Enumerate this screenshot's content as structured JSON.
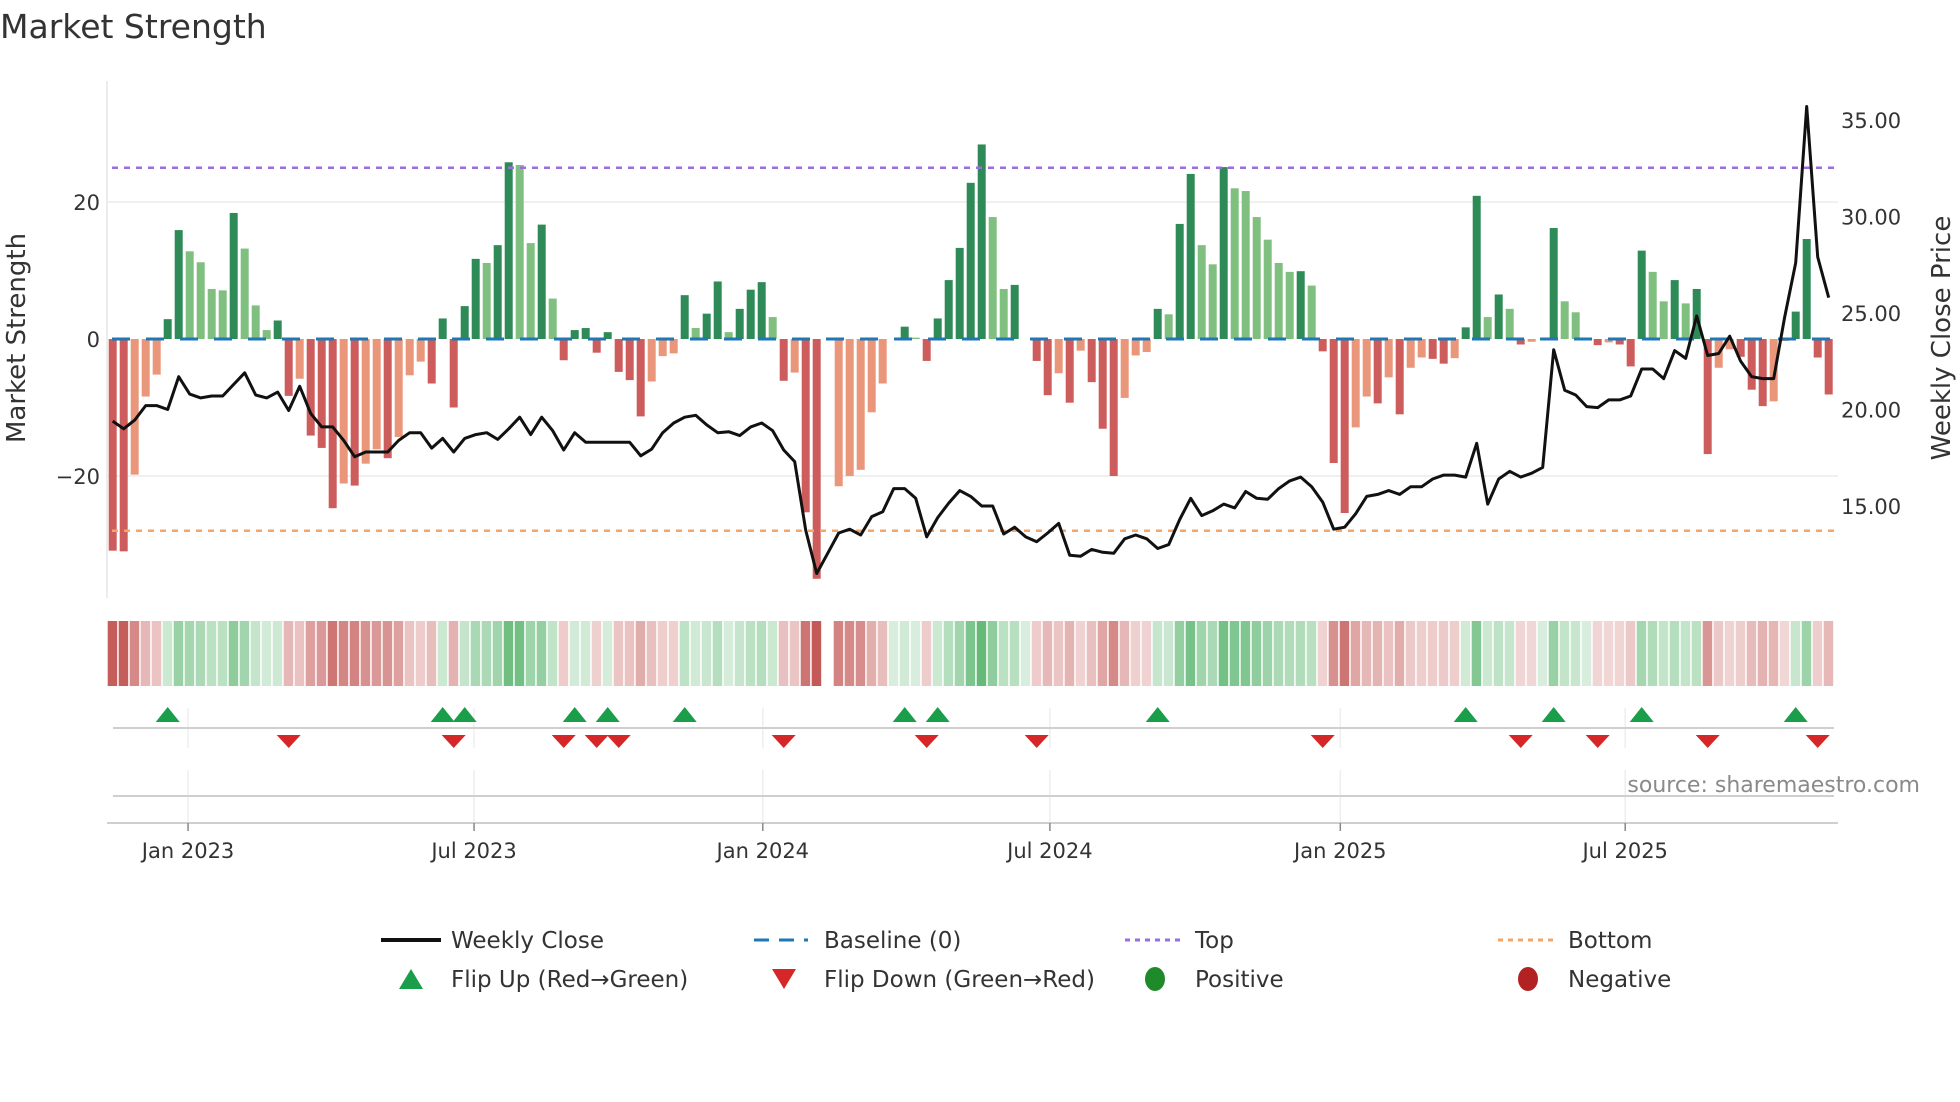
{
  "title": "Market Strength",
  "source": "source: sharemaestro.com",
  "chart_data": {
    "type": "bar",
    "title": "Market Strength",
    "ylabel": "Market Strength",
    "y2label": "Weekly Close Price",
    "ylim": [
      -38,
      35
    ],
    "y2lim": [
      10.5,
      36.5
    ],
    "yticks": [
      {
        "v": 20,
        "label": "20"
      },
      {
        "v": 0,
        "label": "0"
      },
      {
        "v": -20,
        "label": "−20"
      }
    ],
    "y2ticks": [
      {
        "v": 35,
        "label": "35.00"
      },
      {
        "v": 30,
        "label": "30.00"
      },
      {
        "v": 25,
        "label": "25.00"
      },
      {
        "v": 20,
        "label": "20.00"
      },
      {
        "v": 15,
        "label": "15.00"
      }
    ],
    "xticks": [
      {
        "week": 6.85,
        "label": "Jan 2023"
      },
      {
        "week": 32.85,
        "label": "Jul 2023"
      },
      {
        "week": 59.1,
        "label": "Jan 2024"
      },
      {
        "week": 85.2,
        "label": "Jul 2024"
      },
      {
        "week": 111.6,
        "label": "Jan 2025"
      },
      {
        "week": 137.5,
        "label": "Jul 2025"
      }
    ],
    "top_level": 25,
    "bottom_level": -28,
    "baseline": 0,
    "grid": true,
    "strength": [
      -30.9,
      -31,
      -19.8,
      -8.4,
      -5.2,
      2.9,
      15.9,
      12.8,
      11.2,
      7.3,
      7.1,
      18.4,
      13.2,
      4.9,
      1.3,
      2.7,
      -8.3,
      -5.8,
      -14.1,
      -15.9,
      -24.7,
      -21.1,
      -21.4,
      -18.2,
      -16.1,
      -17.4,
      -14.3,
      -5.3,
      -3.3,
      -6.5,
      3.0,
      -10.0,
      4.8,
      11.7,
      11.1,
      13.7,
      25.8,
      25.4,
      14.0,
      16.7,
      5.9,
      -3.1,
      1.3,
      1.6,
      -2.0,
      1.0,
      -4.8,
      -6.0,
      -11.3,
      -6.2,
      -2.5,
      -2.1,
      6.4,
      1.6,
      3.7,
      8.4,
      1.0,
      4.4,
      7.2,
      8.3,
      3.2,
      -6.1,
      -4.9,
      -25.3,
      -35.0,
      null,
      -21.5,
      -20.0,
      -19.1,
      -10.7,
      -6.5,
      0,
      1.8,
      0.2,
      -3.2,
      3.0,
      8.6,
      13.3,
      22.8,
      28.4,
      17.8,
      7.3,
      7.9,
      0,
      -3.2,
      -8.2,
      -5.0,
      -9.3,
      -1.7,
      -6.3,
      -13.1,
      -20.0,
      -8.6,
      -2.4,
      -1.9,
      4.4,
      3.6,
      16.8,
      24.1,
      13.7,
      10.9,
      25.1,
      22.0,
      21.6,
      17.8,
      14.5,
      11.1,
      9.8,
      9.9,
      7.8,
      -1.8,
      -18.1,
      -25.4,
      -12.9,
      -8.4,
      -9.4,
      -5.6,
      -11.0,
      -4.2,
      -2.7,
      -2.9,
      -3.6,
      -2.8,
      1.7,
      20.9,
      3.2,
      6.5,
      4.4,
      -0.8,
      -0.4,
      0,
      16.2,
      5.5,
      3.9,
      0,
      -0.9,
      -0.5,
      -0.8,
      -4.0,
      12.9,
      9.8,
      5.5,
      8.6,
      5.2,
      7.3,
      -16.8,
      -4.2,
      -1.5,
      -2.6,
      -7.4,
      -9.8,
      -9.1,
      -0.3,
      4.0,
      14.6,
      -2.7,
      -8.1
    ],
    "weekly_close": [
      19.4,
      19.0,
      19.45,
      20.2,
      20.2,
      20.0,
      21.7,
      20.8,
      20.6,
      20.7,
      20.7,
      21.3,
      21.9,
      20.75,
      20.6,
      20.9,
      19.95,
      21.2,
      19.8,
      19.1,
      19.1,
      18.4,
      17.55,
      17.8,
      17.8,
      17.8,
      18.4,
      18.8,
      18.8,
      18.0,
      18.5,
      17.8,
      18.5,
      18.7,
      18.8,
      18.45,
      19.0,
      19.6,
      18.7,
      19.6,
      18.9,
      17.9,
      18.8,
      18.3,
      18.3,
      18.3,
      18.3,
      18.3,
      17.6,
      17.95,
      18.8,
      19.3,
      19.6,
      19.7,
      19.2,
      18.8,
      18.85,
      18.65,
      19.1,
      19.3,
      18.9,
      17.9,
      17.3,
      13.75,
      11.5,
      12.55,
      13.6,
      13.8,
      13.5,
      14.45,
      14.7,
      15.9,
      15.9,
      15.4,
      13.4,
      14.4,
      15.15,
      15.8,
      15.5,
      15.0,
      15.0,
      13.55,
      13.9,
      13.4,
      13.15,
      13.6,
      14.1,
      12.45,
      12.4,
      12.75,
      12.6,
      12.55,
      13.3,
      13.5,
      13.3,
      12.8,
      13.0,
      14.3,
      15.4,
      14.5,
      14.75,
      15.1,
      14.9,
      15.75,
      15.4,
      15.35,
      15.9,
      16.3,
      16.5,
      16.0,
      15.2,
      13.8,
      13.9,
      14.6,
      15.5,
      15.6,
      15.8,
      15.6,
      16.0,
      16.0,
      16.4,
      16.6,
      16.6,
      16.5,
      18.25,
      15.1,
      16.4,
      16.8,
      16.5,
      16.7,
      17.0,
      23.1,
      21.0,
      20.75,
      20.15,
      20.1,
      20.5,
      20.5,
      20.7,
      22.1,
      22.1,
      21.6,
      23.05,
      22.65,
      24.85,
      22.8,
      22.9,
      23.8,
      22.5,
      21.7,
      21.6,
      21.6,
      24.8,
      27.6,
      35.7,
      27.9,
      25.8
    ],
    "flip_up_weeks": [
      5,
      30,
      32,
      42,
      45,
      52,
      72,
      75,
      95,
      123,
      131,
      139,
      153
    ],
    "flip_down_weeks": [
      16,
      31,
      41,
      44,
      46,
      61,
      74,
      84,
      110,
      128,
      135,
      145,
      155
    ],
    "legend": [
      {
        "label": "Weekly Close",
        "symbol": "line",
        "color": "#111111"
      },
      {
        "label": "Baseline (0)",
        "symbol": "dash",
        "color": "#1f77b4"
      },
      {
        "label": "Top",
        "symbol": "dot",
        "color": "#9b6ee0"
      },
      {
        "label": "Bottom",
        "symbol": "dot",
        "color": "#f2a66a"
      },
      {
        "label": "Flip Up (Red→Green)",
        "symbol": "triangle-up",
        "color": "#1a9e4a"
      },
      {
        "label": "Flip Down (Green→Red)",
        "symbol": "triangle-down",
        "color": "#d62728"
      },
      {
        "label": "Positive",
        "symbol": "circle",
        "color": "#1e8a2a"
      },
      {
        "label": "Negative",
        "symbol": "circle",
        "color": "#b22222"
      }
    ],
    "legend_placement": "bottom",
    "colors": {
      "pos_strong": "#2e8b57",
      "pos_weak": "#7fbf7f",
      "neg_strong": "#cd5c5c",
      "neg_weak": "#e9967a",
      "heat_pos": "#4caf62",
      "heat_neg": "#c0504d",
      "grid": "#ececec"
    }
  }
}
